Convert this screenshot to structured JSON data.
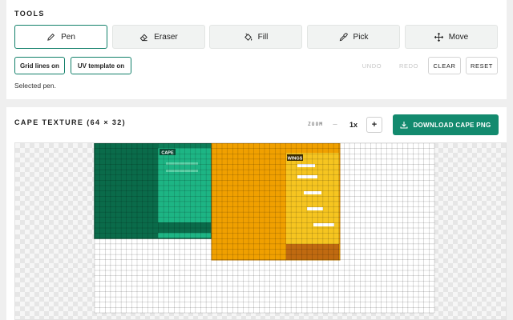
{
  "tools": {
    "title": "TOOLS",
    "buttons": [
      {
        "label": "Pen",
        "icon": "pen-icon",
        "active": true
      },
      {
        "label": "Eraser",
        "icon": "eraser-icon",
        "active": false
      },
      {
        "label": "Fill",
        "icon": "fill-bucket-icon",
        "active": false
      },
      {
        "label": "Pick",
        "icon": "eyedropper-icon",
        "active": false
      },
      {
        "label": "Move",
        "icon": "move-arrows-icon",
        "active": false
      }
    ],
    "grid_toggle": "Grid lines on",
    "uv_toggle": "UV template on",
    "undo": "UNDO",
    "redo": "REDO",
    "clear": "CLEAR",
    "reset": "RESET",
    "status": "Selected pen."
  },
  "cape": {
    "title": "CAPE TEXTURE (64 × 32)",
    "zoom_label": "ZOOM",
    "zoom_minus": "−",
    "zoom_value": "1x",
    "zoom_plus": "+",
    "download": "DOWNLOAD CAPE PNG",
    "cape_region_label": "CAPE",
    "wings_region_label": "WINGS"
  },
  "colors": {
    "accent": "#138a6e",
    "cape_dark": "#0a6b4a",
    "cape_light": "#1db584",
    "wings_orange": "#f0a000",
    "wings_yellow": "#f6c520",
    "wings_bottom": "#c06a10"
  }
}
